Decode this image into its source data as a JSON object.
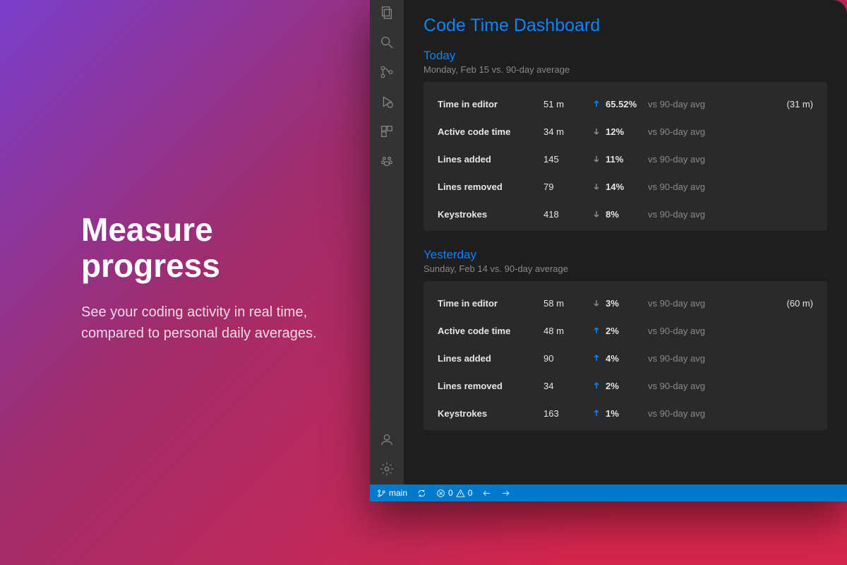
{
  "promo": {
    "headline": "Measure progress",
    "sub": "See your coding activity in real time, compared to personal daily averages."
  },
  "dashboard": {
    "title": "Code Time Dashboard",
    "sections": [
      {
        "title": "Today",
        "subtitle": "Monday, Feb 15 vs. 90-day average",
        "rows": [
          {
            "label": "Time in editor",
            "value": "51 m",
            "dir": "up",
            "pct": "65.52%",
            "vs": "vs 90-day avg",
            "ref": "(31 m)"
          },
          {
            "label": "Active code time",
            "value": "34 m",
            "dir": "down",
            "pct": "12%",
            "vs": "vs 90-day avg",
            "ref": ""
          },
          {
            "label": "Lines added",
            "value": "145",
            "dir": "down",
            "pct": "11%",
            "vs": "vs 90-day avg",
            "ref": ""
          },
          {
            "label": "Lines removed",
            "value": "79",
            "dir": "down",
            "pct": "14%",
            "vs": "vs 90-day avg",
            "ref": ""
          },
          {
            "label": "Keystrokes",
            "value": "418",
            "dir": "down",
            "pct": "8%",
            "vs": "vs 90-day avg",
            "ref": ""
          }
        ]
      },
      {
        "title": "Yesterday",
        "subtitle": "Sunday, Feb 14 vs. 90-day average",
        "rows": [
          {
            "label": "Time in editor",
            "value": "58 m",
            "dir": "down",
            "pct": "3%",
            "vs": "vs 90-day avg",
            "ref": "(60 m)"
          },
          {
            "label": "Active code time",
            "value": "48 m",
            "dir": "up",
            "pct": "2%",
            "vs": "vs 90-day avg",
            "ref": ""
          },
          {
            "label": "Lines added",
            "value": "90",
            "dir": "up",
            "pct": "4%",
            "vs": "vs 90-day avg",
            "ref": ""
          },
          {
            "label": "Lines removed",
            "value": "34",
            "dir": "up",
            "pct": "2%",
            "vs": "vs 90-day avg",
            "ref": ""
          },
          {
            "label": "Keystrokes",
            "value": "163",
            "dir": "up",
            "pct": "1%",
            "vs": "vs 90-day avg",
            "ref": ""
          }
        ]
      }
    ]
  },
  "statusbar": {
    "branch": "main",
    "errors": "0",
    "warnings": "0"
  }
}
